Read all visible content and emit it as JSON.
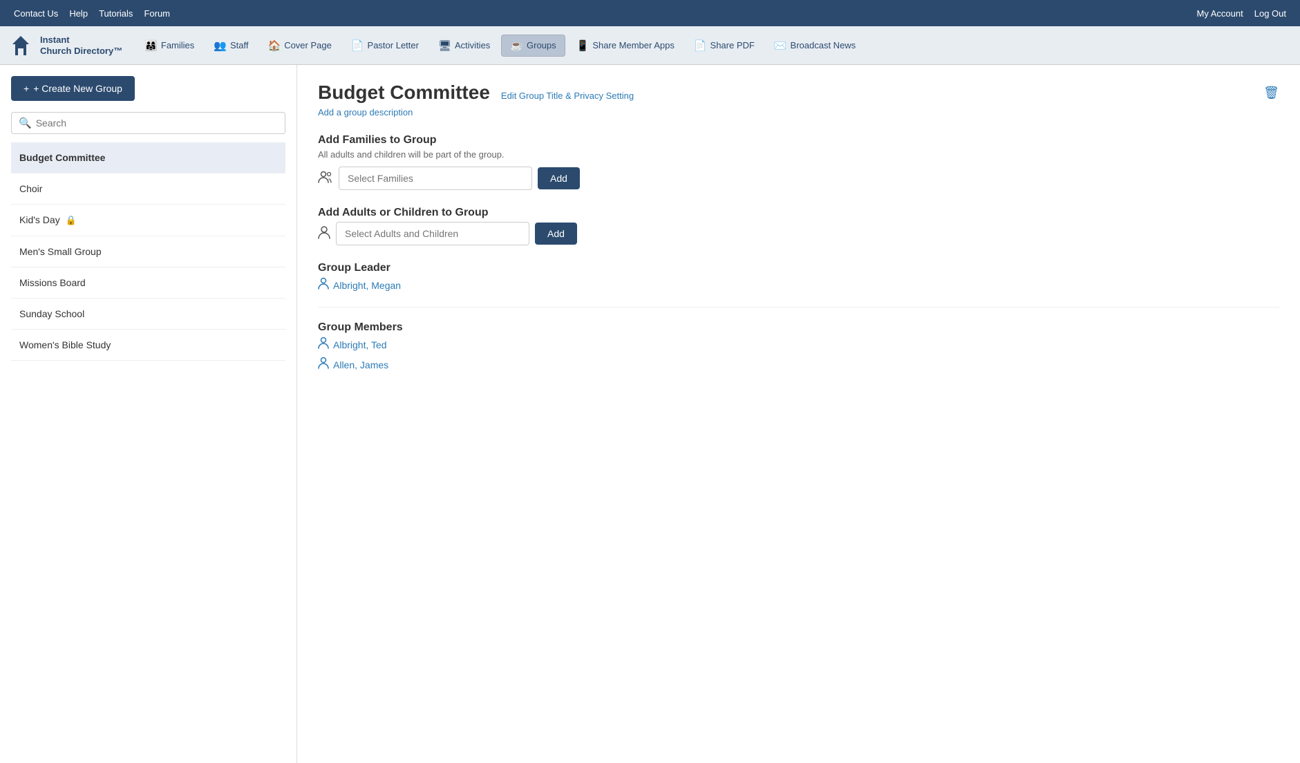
{
  "topbar": {
    "links": [
      "Contact Us",
      "Help",
      "Tutorials",
      "Forum"
    ],
    "right_links": [
      "My Account",
      "Log Out"
    ]
  },
  "logo": {
    "line1": "Instant",
    "line2": "Church Directory™"
  },
  "nav": {
    "items": [
      {
        "id": "families",
        "label": "Families",
        "icon": "👨‍👩‍👧"
      },
      {
        "id": "staff",
        "label": "Staff",
        "icon": "👥"
      },
      {
        "id": "cover-page",
        "label": "Cover Page",
        "icon": "🏠"
      },
      {
        "id": "pastor-letter",
        "label": "Pastor Letter",
        "icon": "📄"
      },
      {
        "id": "activities",
        "label": "Activities",
        "icon": "🖥"
      },
      {
        "id": "groups",
        "label": "Groups",
        "icon": "☕",
        "active": true
      },
      {
        "id": "share-member-apps",
        "label": "Share Member Apps",
        "icon": "📱"
      },
      {
        "id": "share-pdf",
        "label": "Share PDF",
        "icon": "📄"
      },
      {
        "id": "broadcast-news",
        "label": "Broadcast News",
        "icon": "✉️"
      }
    ]
  },
  "sidebar": {
    "create_button": "+ Create New Group",
    "search_placeholder": "Search",
    "groups": [
      {
        "id": "budget-committee",
        "label": "Budget Committee",
        "active": true,
        "locked": false
      },
      {
        "id": "choir",
        "label": "Choir",
        "active": false,
        "locked": false
      },
      {
        "id": "kids-day",
        "label": "Kid's Day",
        "active": false,
        "locked": true
      },
      {
        "id": "mens-small-group",
        "label": "Men's Small Group",
        "active": false,
        "locked": false
      },
      {
        "id": "missions-board",
        "label": "Missions Board",
        "active": false,
        "locked": false
      },
      {
        "id": "sunday-school",
        "label": "Sunday School",
        "active": false,
        "locked": false
      },
      {
        "id": "womens-bible-study",
        "label": "Women's Bible Study",
        "active": false,
        "locked": false
      }
    ]
  },
  "main": {
    "group_title": "Budget Committee",
    "edit_link": "Edit Group Title & Privacy Setting",
    "add_description": "Add a group description",
    "delete_icon": "🗑",
    "add_families": {
      "section_title": "Add Families to Group",
      "section_desc": "All adults and children will be part of the group.",
      "placeholder": "Select Families",
      "button_label": "Add"
    },
    "add_adults": {
      "section_title": "Add Adults or Children to Group",
      "placeholder": "Select Adults and Children",
      "button_label": "Add"
    },
    "group_leader": {
      "section_title": "Group Leader",
      "leader": "Albright, Megan"
    },
    "group_members": {
      "section_title": "Group Members",
      "members": [
        "Albright, Ted",
        "Allen, James"
      ]
    }
  }
}
